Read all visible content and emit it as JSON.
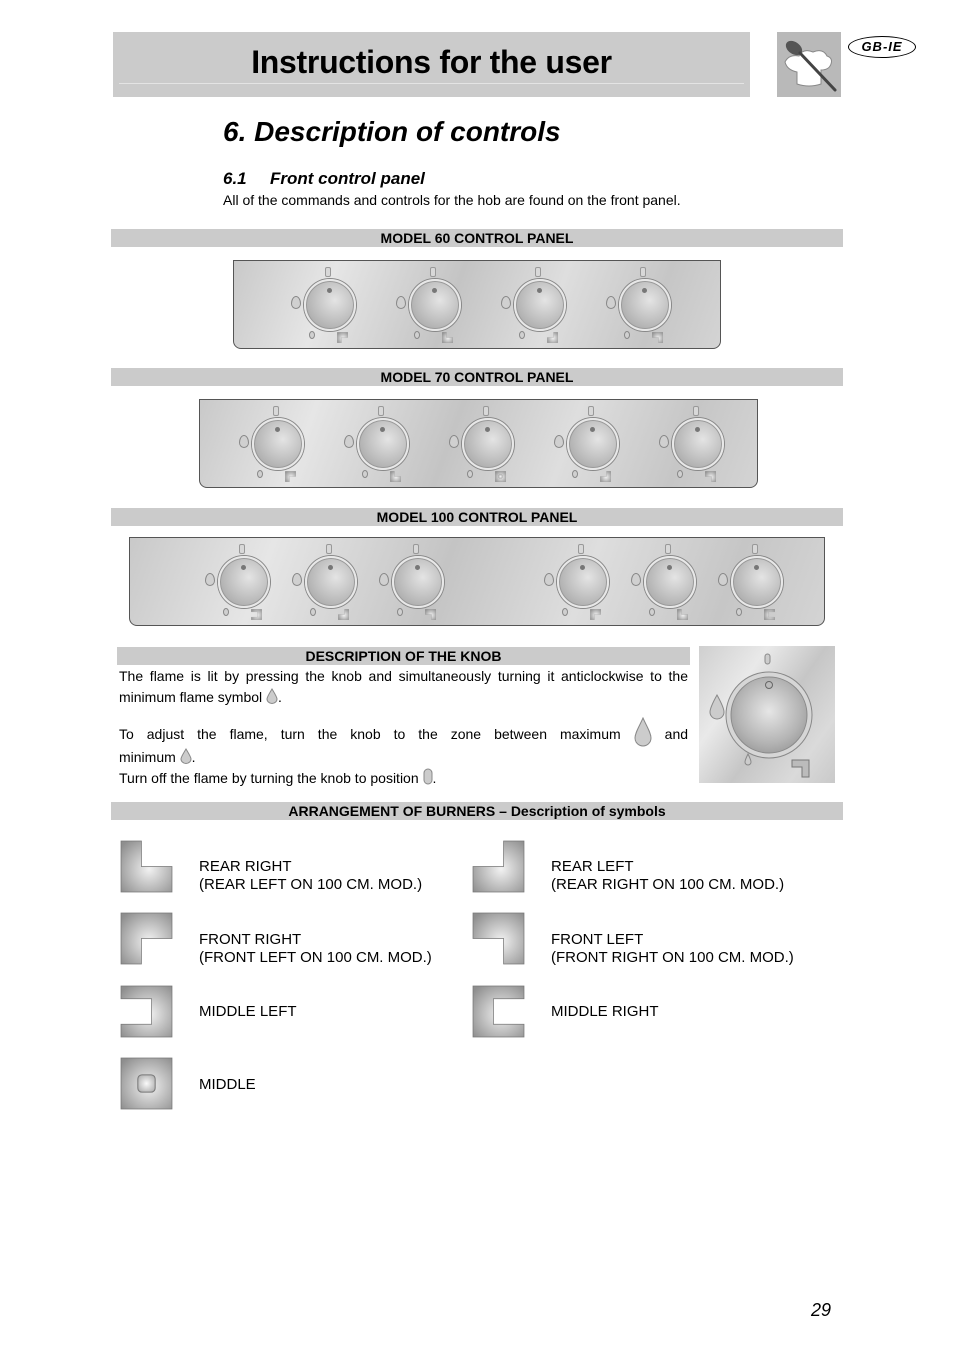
{
  "header": {
    "title": "Instructions for the user",
    "lang_badge": "GB-IE",
    "logo_icon": "chef-spoon-logo-icon"
  },
  "section": {
    "title": "6. Description of controls",
    "subsection_number": "6.1",
    "subsection_title": "Front control panel",
    "intro": "All of the commands and controls for the hob are found on the front panel."
  },
  "panels": [
    {
      "label": "MODEL 60 CONTROL PANEL",
      "knobs": [
        "front-right",
        "rear-right",
        "rear-left",
        "front-left"
      ]
    },
    {
      "label": "MODEL 70 CONTROL PANEL",
      "knobs": [
        "front-right",
        "rear-right",
        "middle",
        "rear-left",
        "front-left"
      ]
    },
    {
      "label": "MODEL 100 CONTROL PANEL",
      "knobs": [
        "middle-left",
        "rear-left",
        "front-left",
        "front-right",
        "rear-right",
        "middle-right"
      ]
    }
  ],
  "knob_description": {
    "title": "DESCRIPTION OF THE KNOB",
    "p1_a": "The flame is lit by pressing the knob and simultaneously turning it anticlockwise to the minimum flame symbol",
    "p1_b": ".",
    "p2_a": "To adjust the flame, turn the knob to the zone between maximum",
    "p2_b": "and minimum",
    "p2_c": ".",
    "p3_a": "Turn off the flame by turning the knob to position",
    "p3_b": "."
  },
  "arrangement": {
    "title": "ARRANGEMENT OF BURNERS – Description of symbols",
    "items": [
      {
        "symbol": "rear-right",
        "line1": "REAR RIGHT",
        "line2": "(REAR LEFT ON 100 CM. MOD.)"
      },
      {
        "symbol": "rear-left",
        "line1": "REAR LEFT",
        "line2": "(REAR RIGHT ON 100 CM. MOD.)"
      },
      {
        "symbol": "front-right",
        "line1": "FRONT RIGHT",
        "line2": "(FRONT LEFT ON 100 CM. MOD.)"
      },
      {
        "symbol": "front-left",
        "line1": "FRONT LEFT",
        "line2": "(FRONT RIGHT ON 100 CM. MOD.)"
      },
      {
        "symbol": "middle-left",
        "line1": "MIDDLE LEFT",
        "line2": ""
      },
      {
        "symbol": "middle-right",
        "line1": "MIDDLE RIGHT",
        "line2": ""
      },
      {
        "symbol": "middle",
        "line1": "MIDDLE",
        "line2": ""
      }
    ]
  },
  "page_number": "29"
}
